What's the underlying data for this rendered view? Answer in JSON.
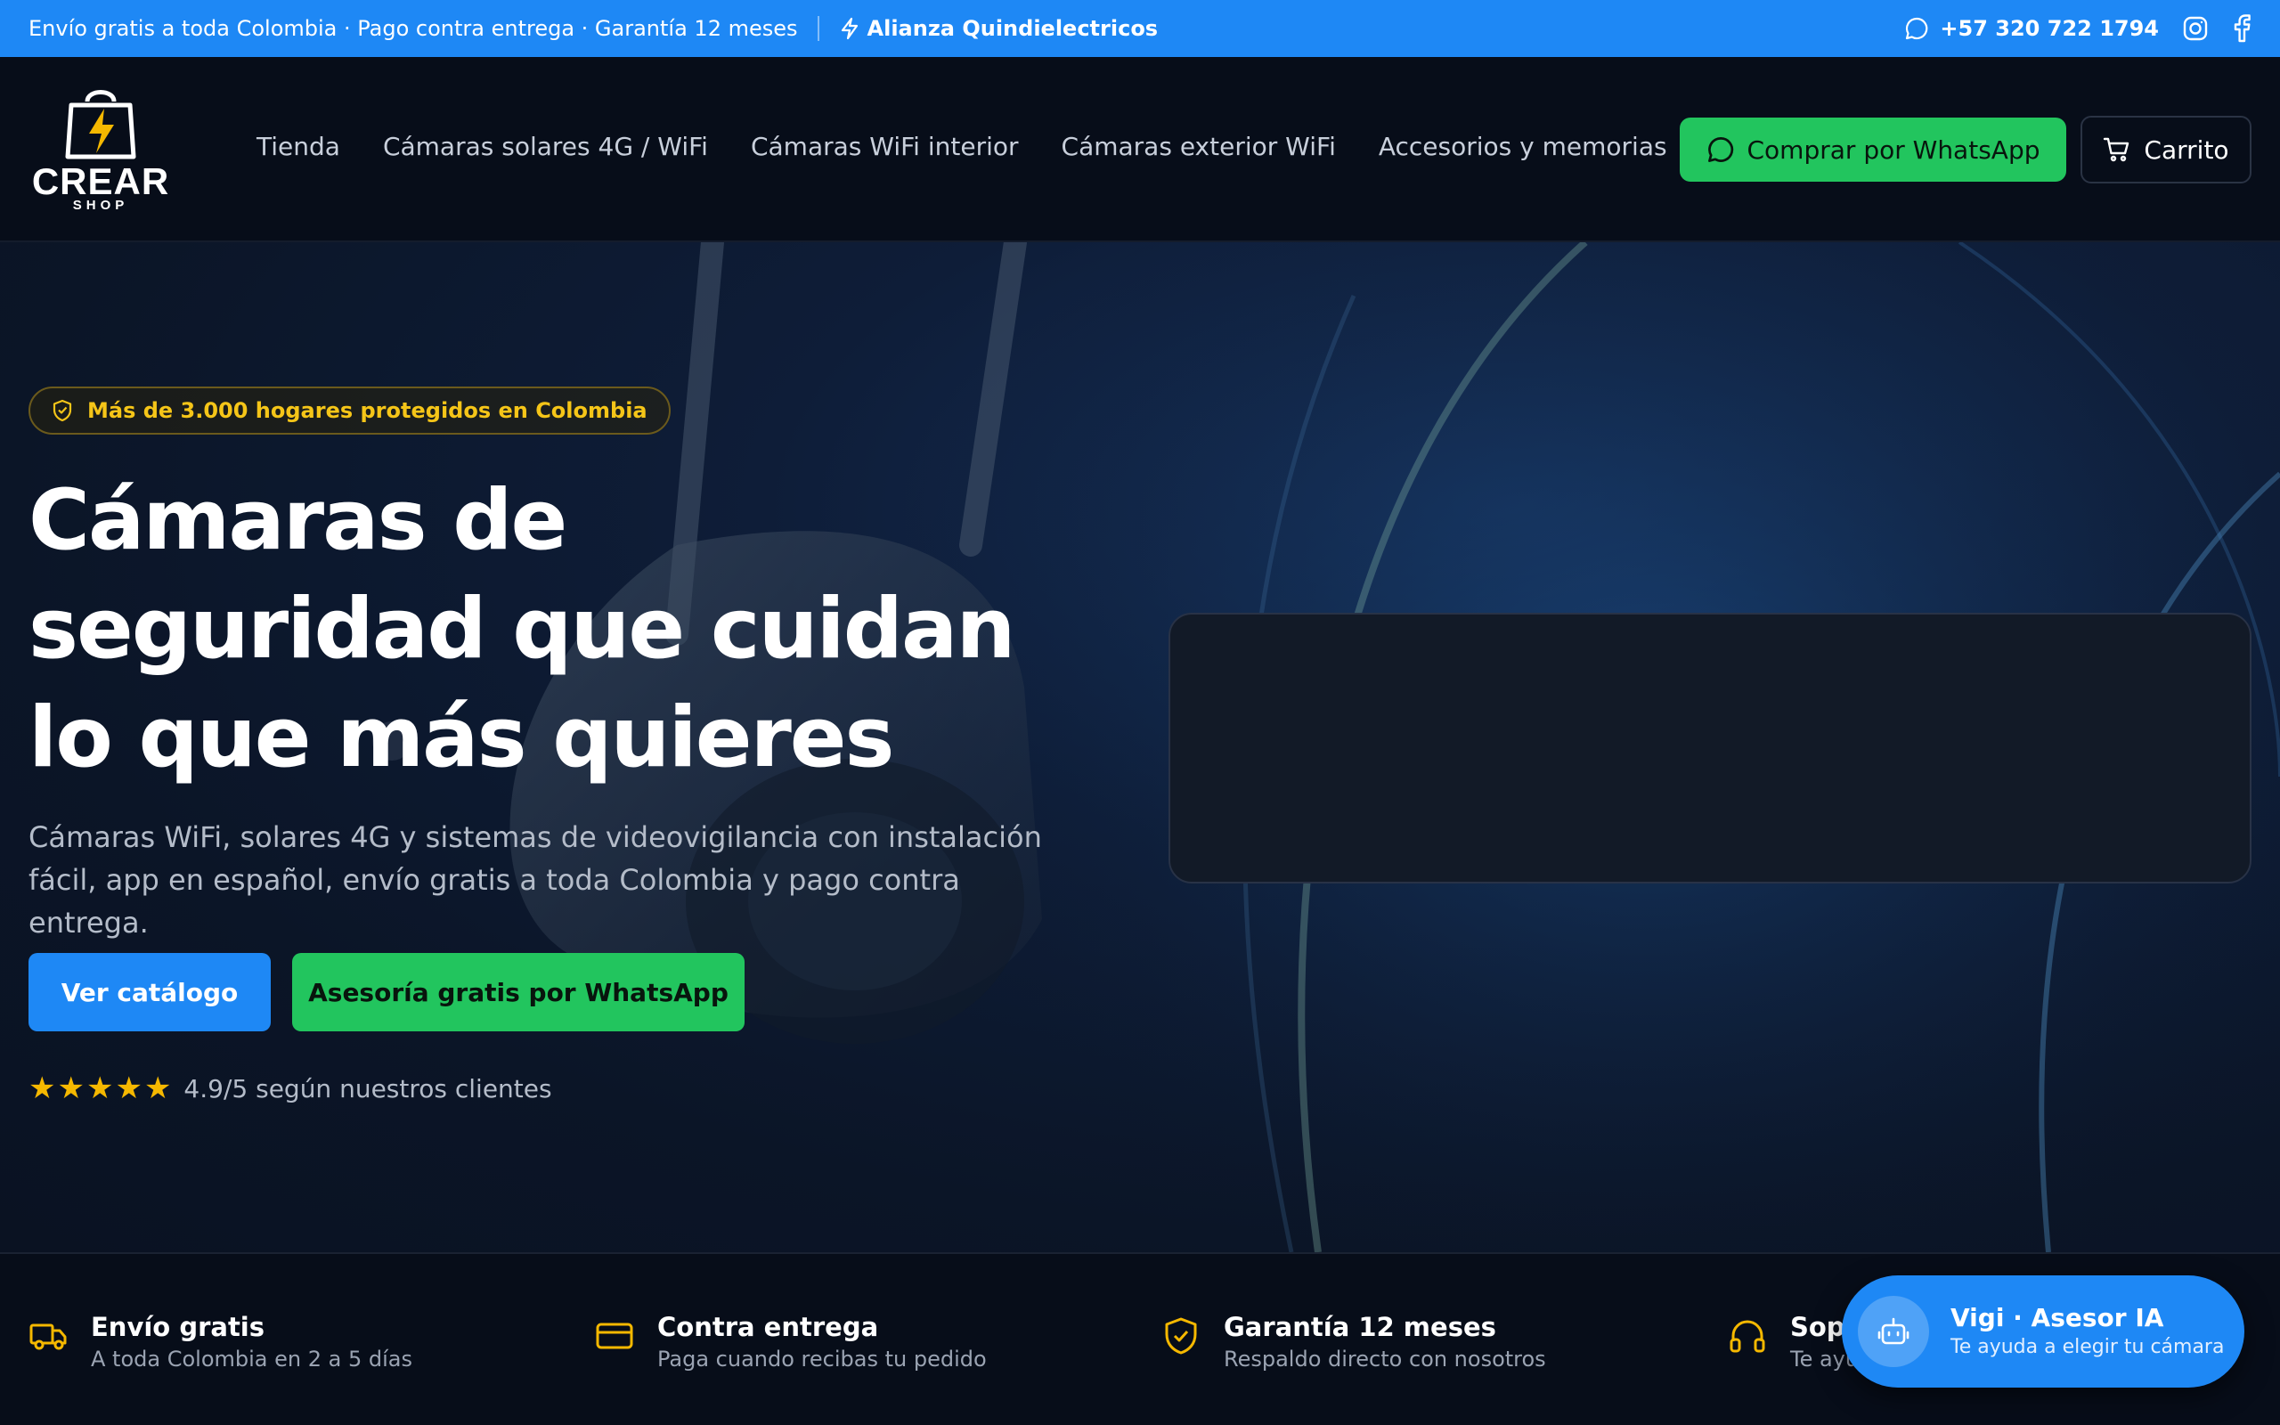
{
  "topbar": {
    "promo": "Envío gratis a toda Colombia · Pago contra entrega · Garantía 12 meses",
    "alliance": "Alianza Quindielectricos",
    "phone": "+57 320 722 1794"
  },
  "logo": {
    "name": "CREAR",
    "sub": "SHOP"
  },
  "nav": {
    "items": [
      {
        "label": "Tienda"
      },
      {
        "label": "Cámaras solares 4G / WiFi"
      },
      {
        "label": "Cámaras WiFi interior"
      },
      {
        "label": "Cámaras exterior WiFi"
      },
      {
        "label": "Accesorios y memorias"
      }
    ]
  },
  "header": {
    "whatsapp_label": "Comprar por WhatsApp",
    "cart_label": "Carrito"
  },
  "hero": {
    "badge": "Más de 3.000 hogares protegidos en Colombia",
    "title": "Cámaras de seguridad que cuidan lo que más quieres",
    "lead": "Cámaras WiFi, solares 4G y sistemas de videovigilancia con instalación fácil, app en español, envío gratis a toda Colombia y pago contra entrega.",
    "catalog_button": "Ver catálogo",
    "advice_button": "Asesoría gratis por WhatsApp",
    "rating_text": "4.9/5 según nuestros clientes",
    "rating_stars": 5
  },
  "features": [
    {
      "title": "Envío gratis",
      "subtitle": "A toda Colombia en 2 a 5 días",
      "icon": "truck-icon"
    },
    {
      "title": "Contra entrega",
      "subtitle": "Paga cuando recibas tu pedido",
      "icon": "credit-card-icon"
    },
    {
      "title": "Garantía 12 meses",
      "subtitle": "Respaldo directo con nosotros",
      "icon": "shield-check-icon"
    },
    {
      "title": "Sopo",
      "subtitle": "Te ayu",
      "icon": "headphones-icon"
    }
  ],
  "chat": {
    "title": "Vigi · Asesor IA",
    "subtitle": "Te ayuda a elegir tu cámara"
  },
  "colors": {
    "accent_blue": "#1e88f5",
    "whatsapp_green": "#22c55e",
    "gold": "#f5b800",
    "background": "#070d19"
  }
}
